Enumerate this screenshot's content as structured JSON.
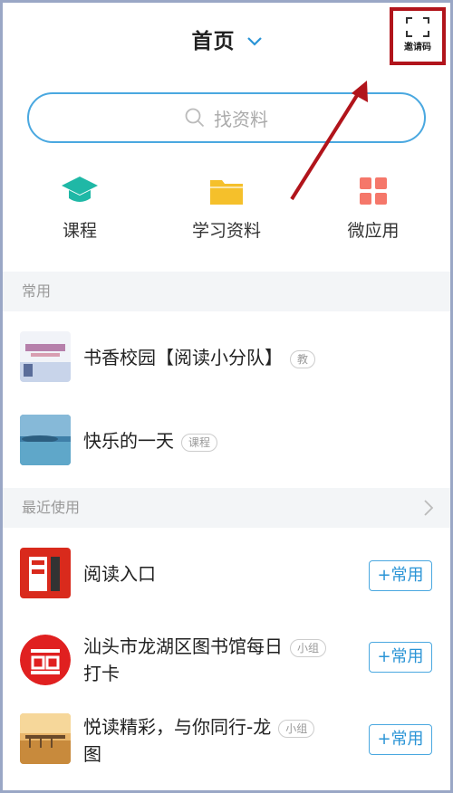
{
  "header": {
    "title": "首页",
    "invite_label": "邀请码"
  },
  "search": {
    "placeholder": "找资料"
  },
  "entries": [
    {
      "label": "课程",
      "icon": "graduation-cap-icon",
      "color": "#1fb8a6"
    },
    {
      "label": "学习资料",
      "icon": "folder-icon",
      "color": "#f5c02b"
    },
    {
      "label": "微应用",
      "icon": "grid-apps-icon",
      "color": "#f5776a"
    }
  ],
  "sections": {
    "common": {
      "title": "常用",
      "items": [
        {
          "title": "书香校园【阅读小分队】",
          "tag": "教"
        },
        {
          "title": "快乐的一天",
          "tag": "课程"
        }
      ]
    },
    "recent": {
      "title": "最近使用",
      "items": [
        {
          "title": "阅读入口",
          "tag": "",
          "button": "+常用"
        },
        {
          "title_line1": "汕头市龙湖区图书馆每日",
          "title_line2": "打卡",
          "tag": "小组",
          "button": "+常用"
        },
        {
          "title_line1": "悦读精彩，与你同行-龙",
          "title_line2": "图",
          "tag": "小组",
          "button": "+常用"
        }
      ]
    }
  },
  "colors": {
    "accent": "#4aa8e0",
    "highlight_box": "#b1141b",
    "annotation_arrow": "#b1141b"
  }
}
